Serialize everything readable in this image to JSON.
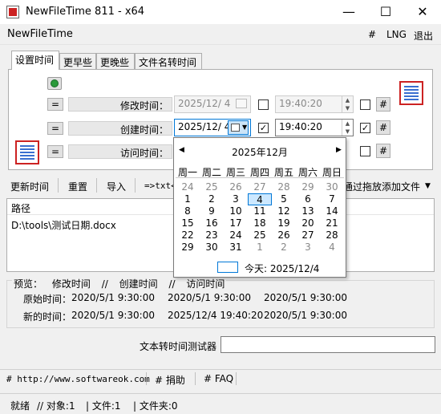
{
  "window": {
    "title": "NewFileTime 811 - x64",
    "minimize": "—",
    "maximize": "☐",
    "close": "✕"
  },
  "menubar": {
    "app_name": "NewFileTime",
    "hash": "#",
    "lng": "LNG",
    "exit": "退出"
  },
  "tabs": [
    "设置时间",
    "更早些",
    "更晚些",
    "文件名转时间"
  ],
  "rows": {
    "modified": {
      "eq": "=",
      "label": "修改时间：",
      "date": "2025/12/ 4",
      "time": "19:40:20",
      "hash": "#"
    },
    "created": {
      "eq": "=",
      "label": "创建时间：",
      "date": "2025/12/ 4",
      "time": "19:40:20",
      "hash": "#"
    },
    "accessed": {
      "eq": "=",
      "label": "访问时间：",
      "hash": "#"
    }
  },
  "toolbar": {
    "update": "更新时间",
    "reset": "重置",
    "import": "导入",
    "to_txt": "=>txt<",
    "drag_add": "通过拖放添加文件",
    "dropdown": "▼"
  },
  "pathlist": {
    "header": "路径",
    "items": [
      "D:\\tools\\测试日期.docx"
    ]
  },
  "preview": {
    "header": [
      "预览：",
      "修改时间",
      "//",
      "创建时间",
      "//",
      "访问时间"
    ],
    "original_label": "原始时间：",
    "original": [
      "2020/5/1 9:30:00",
      "2020/5/1 9:30:00",
      "2020/5/1 9:30:00"
    ],
    "new_label": "新的时间：",
    "new": [
      "2020/5/1 9:30:00",
      "2025/12/4 19:40:20",
      "2020/5/1 9:30:00"
    ]
  },
  "tester": {
    "label": "文本转时间测试器",
    "value": ""
  },
  "links": [
    "# http://www.softwareok.com",
    "# 捐助",
    "# FAQ"
  ],
  "status": {
    "ready": "就绪",
    "objects": "// 对象:1",
    "files": "| 文件:1",
    "folders": "| 文件夹:0"
  },
  "calendar": {
    "prev": "◀",
    "next": "▶",
    "month_label": "2025年12月",
    "weekdays": [
      "周一",
      "周二",
      "周三",
      "周四",
      "周五",
      "周六",
      "周日"
    ],
    "weeks": [
      [
        "24",
        "25",
        "26",
        "27",
        "28",
        "29",
        "30"
      ],
      [
        "1",
        "2",
        "3",
        "4",
        "5",
        "6",
        "7"
      ],
      [
        "8",
        "9",
        "10",
        "11",
        "12",
        "13",
        "14"
      ],
      [
        "15",
        "16",
        "17",
        "18",
        "19",
        "20",
        "21"
      ],
      [
        "22",
        "23",
        "24",
        "25",
        "26",
        "27",
        "28"
      ],
      [
        "29",
        "30",
        "31",
        "1",
        "2",
        "3",
        "4"
      ]
    ],
    "selected_day": "4",
    "today": "今天: 2025/12/4"
  }
}
